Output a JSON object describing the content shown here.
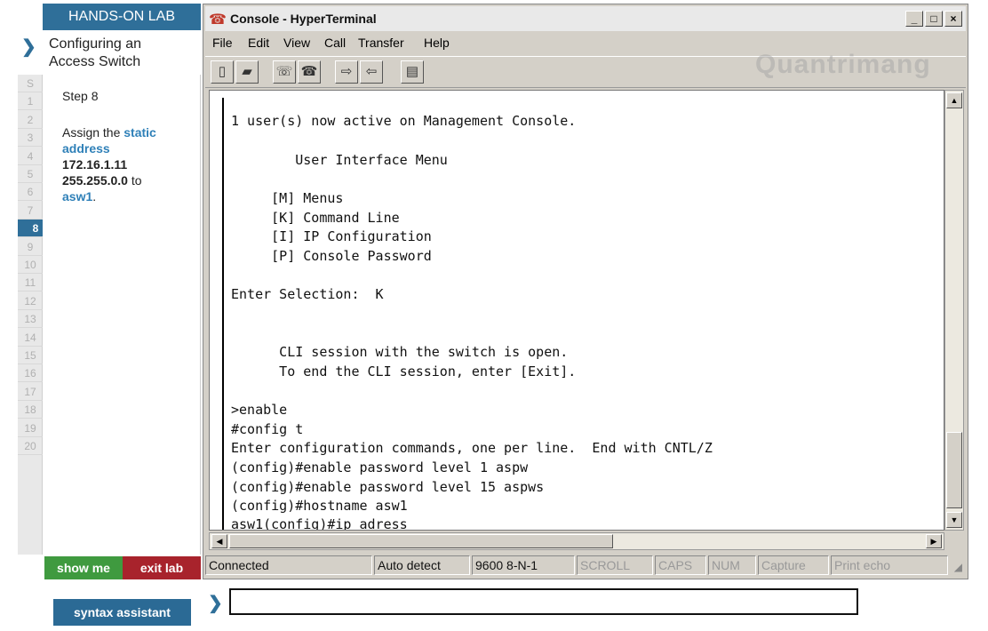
{
  "lab": {
    "header": "HANDS-ON LAB",
    "title_line1": "Configuring an",
    "title_line2": "Access Switch",
    "step_label": "Step 8",
    "instruction": {
      "p1": "Assign the ",
      "h1": "static address",
      "v1": "172.16.1.11",
      "v2": "255.255.0.0",
      "p2": " to",
      "h2": "asw1",
      "p3": "."
    },
    "steps": [
      "S",
      "1",
      "2",
      "3",
      "4",
      "5",
      "6",
      "7",
      "8",
      "9",
      "10",
      "11",
      "12",
      "13",
      "14",
      "15",
      "16",
      "17",
      "18",
      "19",
      "20"
    ],
    "current_step": "8",
    "show_me": "show me",
    "exit_lab": "exit lab",
    "syntax_assistant": "syntax assistant"
  },
  "window": {
    "title": "Console - HyperTerminal",
    "menus": [
      "File",
      "Edit",
      "View",
      "Call",
      "Transfer",
      "Help"
    ],
    "controls": [
      "_",
      "□",
      "×"
    ]
  },
  "terminal": {
    "lines": [
      "1 user(s) now active on Management Console.",
      "        User Interface Menu",
      "     [M] Menus",
      "     [K] Command Line",
      "     [I] IP Configuration",
      "     [P] Console Password",
      "Enter Selection:  K",
      "      CLI session with the switch is open.",
      "      To end the CLI session, enter [Exit].",
      ">enable",
      "#config t",
      "Enter configuration commands, one per line.  End with CNTL/Z",
      "(config)#enable password level 1 aspw",
      "(config)#enable password level 15 aspws",
      "(config)#hostname asw1",
      "asw1(config)#ip adress"
    ]
  },
  "status": {
    "connected": "Connected",
    "detect": "Auto detect",
    "settings": "9600 8-N-1",
    "scroll": "SCROLL",
    "caps": "CAPS",
    "num": "NUM",
    "capture": "Capture",
    "print_echo": "Print echo"
  },
  "watermark": "Quantrimang",
  "command": {
    "value": "",
    "prompt_icon": "chevron-right-icon"
  }
}
